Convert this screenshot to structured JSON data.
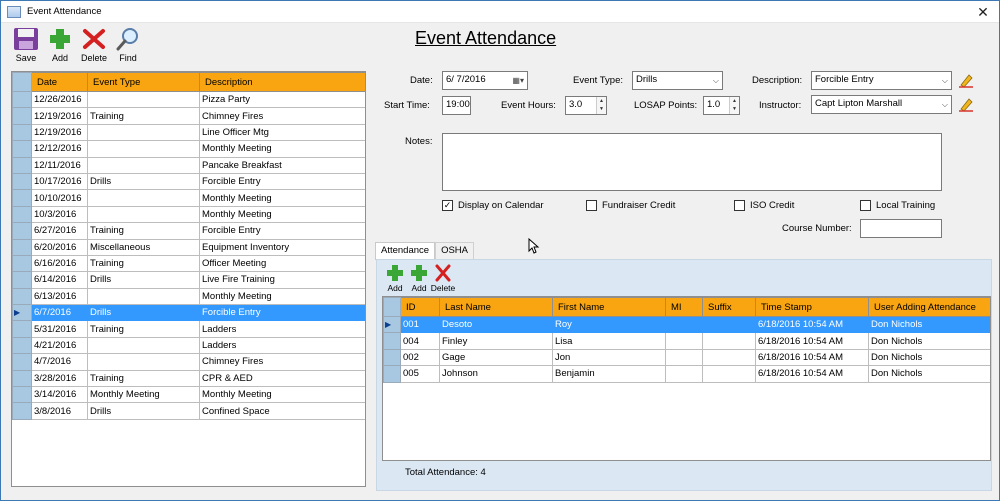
{
  "window": {
    "title": "Event Attendance",
    "close": "✕"
  },
  "toolbar": {
    "save": "Save",
    "add": "Add",
    "delete": "Delete",
    "find": "Find"
  },
  "page_title": "Event Attendance",
  "events_grid": {
    "columns": [
      "Date",
      "Event Type",
      "Description"
    ],
    "rows": [
      [
        "12/26/2016",
        "",
        "Pizza Party"
      ],
      [
        "12/19/2016",
        "Training",
        "Chimney Fires"
      ],
      [
        "12/19/2016",
        "",
        "Line Officer Mtg"
      ],
      [
        "12/12/2016",
        "",
        "Monthly Meeting"
      ],
      [
        "12/11/2016",
        "",
        "Pancake Breakfast"
      ],
      [
        "10/17/2016",
        "Drills",
        "Forcible Entry"
      ],
      [
        "10/10/2016",
        "",
        "Monthly Meeting"
      ],
      [
        "10/3/2016",
        "",
        "Monthly Meeting"
      ],
      [
        "6/27/2016",
        "Training",
        "Forcible Entry"
      ],
      [
        "6/20/2016",
        "Miscellaneous",
        "Equipment Inventory"
      ],
      [
        "6/16/2016",
        "Training",
        "Officer Meeting"
      ],
      [
        "6/14/2016",
        "Drills",
        "Live Fire Training"
      ],
      [
        "6/13/2016",
        "",
        "Monthly Meeting"
      ],
      [
        "6/7/2016",
        "Drills",
        "Forcible Entry"
      ],
      [
        "5/31/2016",
        "Training",
        "Ladders"
      ],
      [
        "4/21/2016",
        "",
        "Ladders"
      ],
      [
        "4/7/2016",
        "",
        "Chimney Fires"
      ],
      [
        "3/28/2016",
        "Training",
        "CPR & AED"
      ],
      [
        "3/14/2016",
        "Monthly Meeting",
        "Monthly Meeting"
      ],
      [
        "3/8/2016",
        "Drills",
        "Confined Space"
      ]
    ],
    "selected_index": 13
  },
  "form": {
    "date_label": "Date:",
    "date_value": "6/ 7/2016",
    "event_type_label": "Event Type:",
    "event_type_value": "Drills",
    "description_label": "Description:",
    "description_value": "Forcible Entry",
    "start_time_label": "Start Time:",
    "start_time_value": "19:00",
    "event_hours_label": "Event Hours:",
    "event_hours_value": "3.0",
    "losap_label": "LOSAP Points:",
    "losap_value": "1.0",
    "instructor_label": "Instructor:",
    "instructor_value": "Capt Lipton Marshall",
    "notes_label": "Notes:",
    "checkboxes": [
      {
        "label": "Display on Calendar",
        "checked": true
      },
      {
        "label": "Fundraiser Credit",
        "checked": false
      },
      {
        "label": "ISO Credit",
        "checked": false
      },
      {
        "label": "Local Training",
        "checked": false
      }
    ],
    "course_number_label": "Course Number:"
  },
  "tabs": [
    "Attendance",
    "OSHA"
  ],
  "attendance_toolbar": {
    "add1": "Add",
    "add2": "Add",
    "delete": "Delete"
  },
  "attendance_grid": {
    "columns": [
      "ID",
      "Last Name",
      "First Name",
      "MI",
      "Suffix",
      "Time Stamp",
      "User Adding Attendance"
    ],
    "rows": [
      [
        "001",
        "Desoto",
        "Roy",
        "",
        "",
        "6/18/2016 10:54 AM",
        "Don Nichols"
      ],
      [
        "004",
        "Finley",
        "Lisa",
        "",
        "",
        "6/18/2016 10:54 AM",
        "Don Nichols"
      ],
      [
        "002",
        "Gage",
        "Jon",
        "",
        "",
        "6/18/2016 10:54 AM",
        "Don Nichols"
      ],
      [
        "005",
        "Johnson",
        "Benjamin",
        "",
        "",
        "6/18/2016 10:54 AM",
        "Don Nichols"
      ]
    ],
    "selected_index": 0
  },
  "total_attendance": "Total Attendance:  4",
  "colors": {
    "header": "#f8a511",
    "selected_row": "#3399ff",
    "panel": "#dbe8f4"
  }
}
